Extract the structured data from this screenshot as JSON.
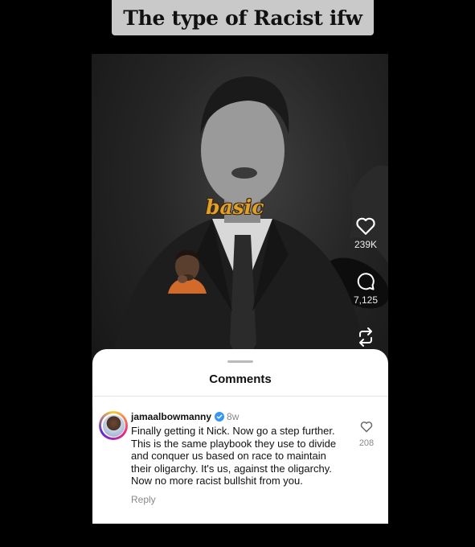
{
  "banner": {
    "title": "The type of Racist ifw"
  },
  "video": {
    "overlay_word": "basic",
    "actions": [
      {
        "icon": "heart-icon",
        "count": "239K"
      },
      {
        "icon": "comment-icon",
        "count": "7,125"
      },
      {
        "icon": "repost-icon",
        "count": ""
      }
    ]
  },
  "comments_sheet": {
    "title": "Comments",
    "comment": {
      "username": "jamaalbowmanny",
      "verified": true,
      "time": "8w",
      "text": "Finally getting it Nick. Now go a step further. This is the same playbook they use to divide and conquer us based on race to maintain their oligarchy. It's us, against the oligarchy. Now no more racist bullshit from you.",
      "reply_label": "Reply",
      "like_count": "208"
    }
  },
  "colors": {
    "verified": "#3797f0",
    "overlay_text": "#e0a12c",
    "banner_bg": "#c9c9c9"
  }
}
